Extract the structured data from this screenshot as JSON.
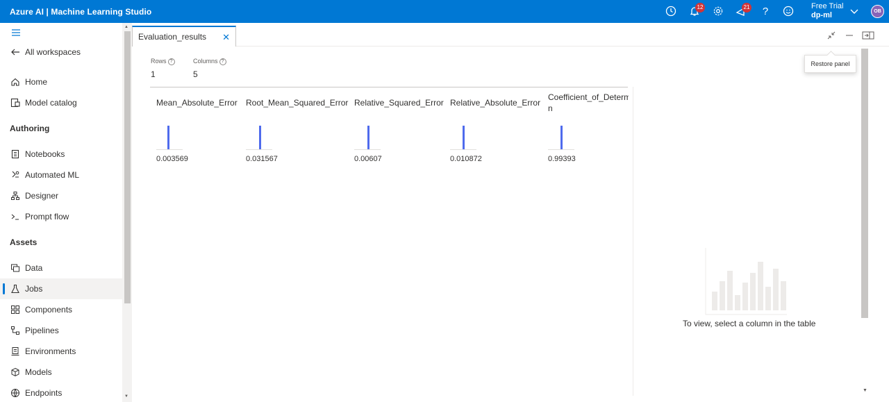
{
  "topbar": {
    "brand": "Azure AI | Machine Learning Studio",
    "notifications_count": "12",
    "feedback_count": "21",
    "account_plan": "Free Trial",
    "account_workspace": "dp-ml",
    "avatar_initials": "OB"
  },
  "sidebar": {
    "all_workspaces": "All workspaces",
    "home": "Home",
    "model_catalog": "Model catalog",
    "authoring_header": "Authoring",
    "notebooks": "Notebooks",
    "automated_ml": "Automated ML",
    "designer": "Designer",
    "prompt_flow": "Prompt flow",
    "assets_header": "Assets",
    "data": "Data",
    "jobs": "Jobs",
    "components": "Components",
    "pipelines": "Pipelines",
    "environments": "Environments",
    "models": "Models",
    "endpoints": "Endpoints"
  },
  "tab": {
    "label": "Evaluation_results"
  },
  "tooltip": {
    "restore_panel": "Restore panel"
  },
  "summary": {
    "rows_label": "Rows",
    "rows_value": "1",
    "columns_label": "Columns",
    "columns_value": "5"
  },
  "table": {
    "columns": [
      {
        "header": "Mean_Absolute_Error",
        "value": "0.003569"
      },
      {
        "header": "Root_Mean_Squared_Error",
        "value": "0.031567"
      },
      {
        "header": "Relative_Squared_Error",
        "value": "0.00607"
      },
      {
        "header": "Relative_Absolute_Error",
        "value": "0.010872"
      },
      {
        "header": "Coefficient_of_Determ",
        "header_wrap": "n",
        "value": "0.99393"
      }
    ]
  },
  "empty_state": {
    "message": "To view, select a column in the table"
  },
  "colors": {
    "accent": "#0078d4",
    "spark": "#4f6bed",
    "badge": "#d13438"
  }
}
